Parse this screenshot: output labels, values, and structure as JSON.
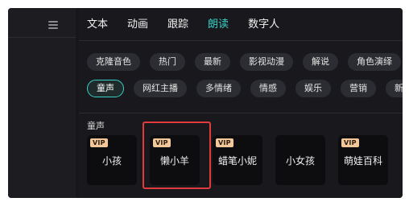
{
  "left_rail": {
    "menu_icon": "hamburger-menu-icon"
  },
  "tabs": [
    {
      "label": "文本",
      "active": false
    },
    {
      "label": "动画",
      "active": false
    },
    {
      "label": "跟踪",
      "active": false
    },
    {
      "label": "朗读",
      "active": true
    },
    {
      "label": "数字人",
      "active": false
    }
  ],
  "categories_row1": [
    "克隆音色",
    "热门",
    "最新",
    "影视动漫",
    "解说",
    "角色演绎"
  ],
  "categories_row2": [
    "童声",
    "网红主播",
    "多情绪",
    "情感",
    "娱乐",
    "营销",
    "新"
  ],
  "active_category": "童声",
  "section_title": "童声",
  "voices": [
    {
      "name": "小孩",
      "vip": true
    },
    {
      "name": "懒小羊",
      "vip": true
    },
    {
      "name": "蜡笔小妮",
      "vip": true
    },
    {
      "name": "小女孩",
      "vip": false
    },
    {
      "name": "萌娃百科",
      "vip": true
    }
  ],
  "vip_label": "VIP",
  "colors": {
    "accent": "#37d0c7",
    "highlight": "#e23b3b",
    "vip_badge": "#f2c89a"
  }
}
